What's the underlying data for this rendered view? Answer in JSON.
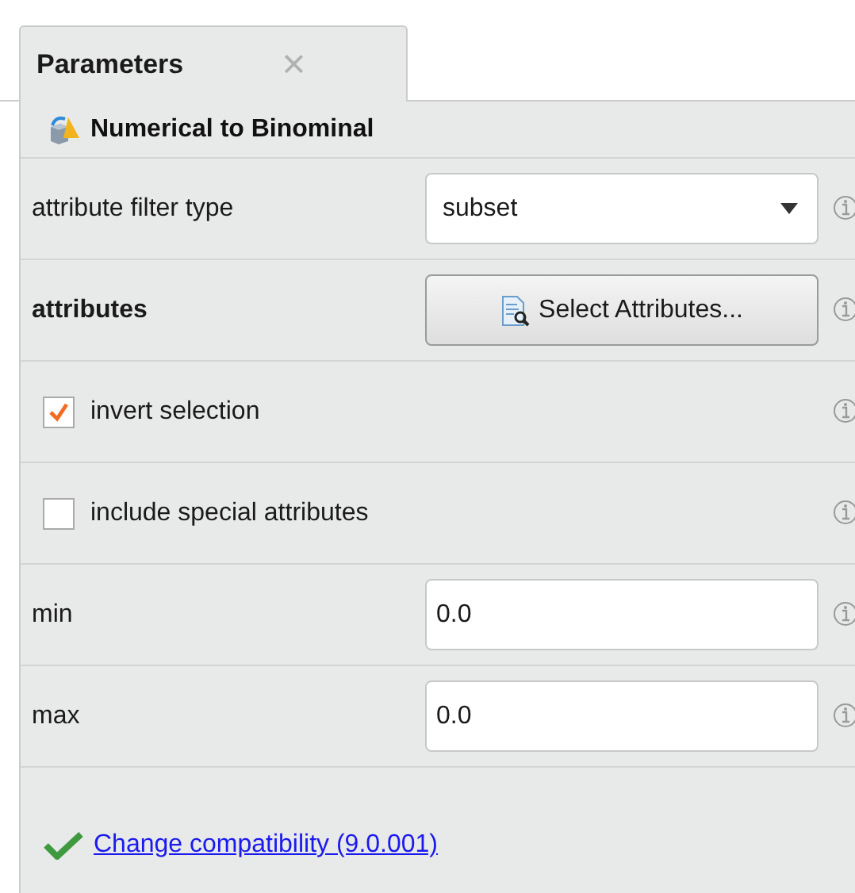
{
  "tab": {
    "label": "Parameters",
    "close": "×"
  },
  "operator": {
    "title": "Numerical to Binominal"
  },
  "parameters": [
    {
      "kind": "dropdown",
      "label": "attribute filter type",
      "value": "subset",
      "bold": false
    },
    {
      "kind": "button",
      "label": "attributes",
      "value": "Select Attributes...",
      "bold": true
    },
    {
      "kind": "checkbox",
      "label": "invert selection",
      "checked": true
    },
    {
      "kind": "checkbox",
      "label": "include special attributes",
      "checked": false
    },
    {
      "kind": "input",
      "label": "min",
      "value": "0.0",
      "bold": false
    },
    {
      "kind": "input",
      "label": "max",
      "value": "0.0",
      "bold": false
    }
  ],
  "footer": {
    "link": "Change compatibility (9.0.001)"
  }
}
